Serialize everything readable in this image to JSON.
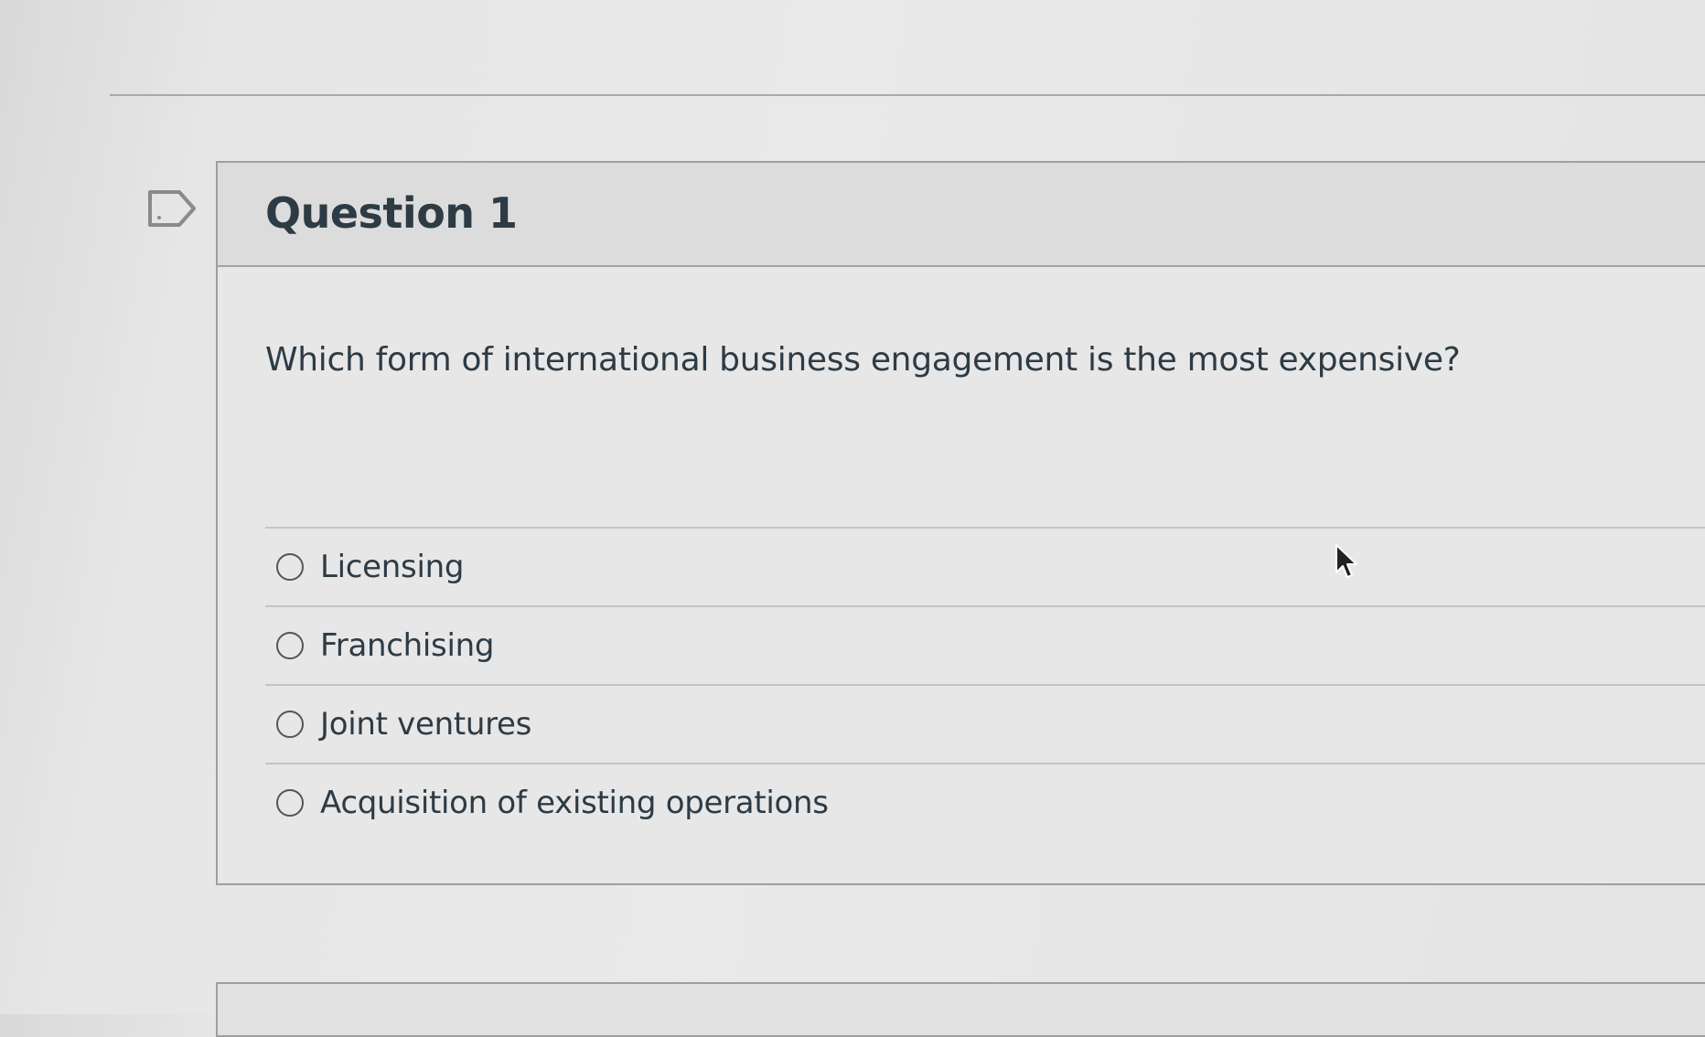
{
  "question": {
    "title": "Question 1",
    "text": "Which form of international business engagement is the most expensive?",
    "flag_icon": "flag-question-icon"
  },
  "answers": [
    {
      "label": "Licensing",
      "selected": false
    },
    {
      "label": "Franchising",
      "selected": false
    },
    {
      "label": "Joint ventures",
      "selected": false
    },
    {
      "label": "Acquisition of existing operations",
      "selected": false
    }
  ],
  "cursor_icon": "mouse-pointer-icon"
}
